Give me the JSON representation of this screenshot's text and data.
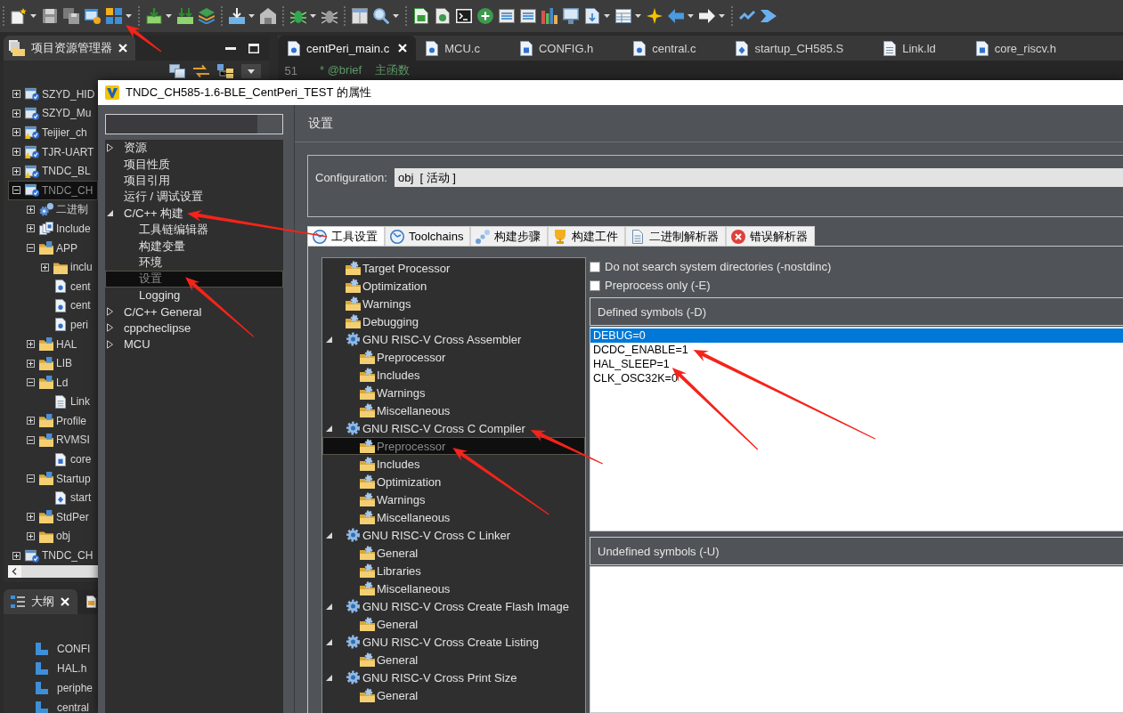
{
  "toolbar": [
    {
      "kind": "separator"
    },
    {
      "kind": "new",
      "dropdown": true,
      "arrow": false
    },
    {
      "kind": "save",
      "dropdown": false,
      "arrow": false
    },
    {
      "kind": "save-all",
      "dropdown": false,
      "arrow": false
    },
    {
      "kind": "window-gear",
      "dropdown": false,
      "arrow": false
    },
    {
      "kind": "grid",
      "dropdown": true,
      "arrow": true
    },
    {
      "kind": "separator"
    },
    {
      "kind": "download",
      "dropdown": true,
      "arrow": false
    },
    {
      "kind": "double-download",
      "dropdown": false,
      "arrow": false
    },
    {
      "kind": "layers",
      "dropdown": false,
      "arrow": false
    },
    {
      "kind": "separator"
    },
    {
      "kind": "tray",
      "dropdown": true,
      "arrow": false
    },
    {
      "kind": "house",
      "dropdown": false,
      "arrow": false
    },
    {
      "kind": "separator"
    },
    {
      "kind": "bug",
      "dropdown": true,
      "arrow": false
    },
    {
      "kind": "bug-off",
      "dropdown": false,
      "arrow": false
    },
    {
      "kind": "separator"
    },
    {
      "kind": "window",
      "dropdown": false,
      "arrow": false
    },
    {
      "kind": "search",
      "dropdown": true,
      "arrow": false
    },
    {
      "kind": "separator"
    },
    {
      "kind": "sheet",
      "dropdown": false,
      "arrow": false
    },
    {
      "kind": "help-doc",
      "dropdown": false,
      "arrow": false
    },
    {
      "kind": "terminal",
      "dropdown": false,
      "arrow": false
    },
    {
      "kind": "plus-circle",
      "dropdown": false,
      "arrow": false
    },
    {
      "kind": "list",
      "dropdown": false,
      "arrow": false
    },
    {
      "kind": "list",
      "dropdown": false,
      "arrow": false
    },
    {
      "kind": "bars",
      "dropdown": false,
      "arrow": false
    },
    {
      "kind": "monitor",
      "dropdown": false,
      "arrow": false
    },
    {
      "kind": "doc-down",
      "dropdown": true,
      "arrow": false
    },
    {
      "kind": "table",
      "dropdown": true,
      "arrow": false
    },
    {
      "kind": "sparkle",
      "dropdown": false,
      "arrow": false
    },
    {
      "kind": "back",
      "dropdown": true,
      "arrow": false
    },
    {
      "kind": "forward",
      "dropdown": true,
      "arrow": false
    },
    {
      "kind": "separator"
    },
    {
      "kind": "zigzag",
      "dropdown": false,
      "arrow": false
    },
    {
      "kind": "chevron",
      "dropdown": false,
      "arrow": false
    }
  ],
  "explorer": {
    "title": "项目资源管理器",
    "tree": [
      {
        "label": "SZYD_HID",
        "kind": "project",
        "expanded": false,
        "selected": false
      },
      {
        "label": "SZYD_Mu",
        "kind": "project",
        "expanded": false,
        "selected": false
      },
      {
        "label": "Teijier_ch",
        "kind": "project-warning",
        "expanded": false,
        "selected": false
      },
      {
        "label": "TJR-UART",
        "kind": "project-warning",
        "expanded": false,
        "selected": false
      },
      {
        "label": "TNDC_BL",
        "kind": "project-warning",
        "expanded": false,
        "selected": false
      },
      {
        "label": "TNDC_CH",
        "kind": "project",
        "expanded": true,
        "selected": true,
        "children": [
          {
            "label": "二进制",
            "kind": "binaries",
            "expanded": false,
            "selected": false
          },
          {
            "label": "Include",
            "kind": "includes",
            "expanded": false,
            "selected": false
          },
          {
            "label": "APP",
            "kind": "source-folder",
            "expanded": true,
            "selected": false,
            "children": [
              {
                "label": "inclu",
                "kind": "folder",
                "expanded": false,
                "selected": false
              },
              {
                "label": "cent",
                "kind": "c-file",
                "selected": false
              },
              {
                "label": "cent",
                "kind": "c-file",
                "selected": false
              },
              {
                "label": "peri",
                "kind": "c-file",
                "selected": false
              }
            ]
          },
          {
            "label": "HAL",
            "kind": "source-folder",
            "expanded": false,
            "selected": false
          },
          {
            "label": "LIB",
            "kind": "source-folder",
            "expanded": false,
            "selected": false
          },
          {
            "label": "Ld",
            "kind": "source-folder",
            "expanded": true,
            "selected": false,
            "children": [
              {
                "label": "Link",
                "kind": "text-file",
                "selected": false
              }
            ]
          },
          {
            "label": "Profile",
            "kind": "source-folder",
            "expanded": false,
            "selected": false
          },
          {
            "label": "RVMSI",
            "kind": "source-folder",
            "expanded": true,
            "selected": false,
            "children": [
              {
                "label": "core",
                "kind": "h-file",
                "selected": false
              }
            ]
          },
          {
            "label": "Startup",
            "kind": "source-folder",
            "expanded": true,
            "selected": false,
            "children": [
              {
                "label": "start",
                "kind": "s-file",
                "selected": false
              }
            ]
          },
          {
            "label": "StdPer",
            "kind": "source-folder",
            "expanded": false,
            "selected": false
          },
          {
            "label": "obj",
            "kind": "folder",
            "expanded": false,
            "selected": false
          }
        ]
      },
      {
        "label": "TNDC_CH",
        "kind": "project",
        "expanded": false,
        "selected": false
      }
    ]
  },
  "outline": {
    "title": "大纲",
    "items": [
      "CONFI",
      "HAL.h",
      "periphe",
      "central"
    ]
  },
  "editor": {
    "tabs": [
      {
        "label": "centPeri_main.c",
        "kind": "c-file",
        "selected": true
      },
      {
        "label": "MCU.c",
        "kind": "c-file",
        "selected": false
      },
      {
        "label": "CONFIG.h",
        "kind": "h-file",
        "selected": false
      },
      {
        "label": "central.c",
        "kind": "c-file",
        "selected": false
      },
      {
        "label": "startup_CH585.S",
        "kind": "s-file",
        "selected": false
      },
      {
        "label": "Link.ld",
        "kind": "text-file",
        "selected": false
      },
      {
        "label": "core_riscv.h",
        "kind": "h-file",
        "selected": false
      }
    ],
    "line_number": "51",
    "code": "* @brief    主函数"
  },
  "dialog": {
    "title": "TNDC_CH585-1.6-BLE_CentPeri_TEST 的属性",
    "nav": [
      {
        "label": "资源",
        "expanded": false,
        "selected": false,
        "arrow": false
      },
      {
        "label": "项目性质",
        "selected": false,
        "arrow": false
      },
      {
        "label": "项目引用",
        "selected": false,
        "arrow": false
      },
      {
        "label": "运行 / 调试设置",
        "selected": false,
        "arrow": false
      },
      {
        "label": "C/C++ 构建",
        "expanded": true,
        "selected": false,
        "arrow": true,
        "children": [
          {
            "label": "工具链编辑器",
            "selected": false,
            "arrow": false
          },
          {
            "label": "构建变量",
            "selected": false,
            "arrow": false
          },
          {
            "label": "环境",
            "selected": false,
            "arrow": false
          },
          {
            "label": "设置",
            "selected": true,
            "arrow": true
          },
          {
            "label": "Logging",
            "selected": false,
            "arrow": false
          }
        ]
      },
      {
        "label": "C/C++ General",
        "expanded": false,
        "selected": false,
        "arrow": false
      },
      {
        "label": "cppcheclipse",
        "expanded": false,
        "selected": false,
        "arrow": false
      },
      {
        "label": "MCU",
        "expanded": false,
        "selected": false,
        "arrow": false
      }
    ],
    "page_title": "设置",
    "configuration": {
      "label": "Configuration:",
      "value": "obj  [ 活动 ]"
    },
    "tabs": [
      {
        "label": "工具设置",
        "kind": "tool-settings",
        "selected": true
      },
      {
        "label": "Toolchains",
        "kind": "toolchains",
        "selected": false
      },
      {
        "label": "构建步骤",
        "kind": "build-steps",
        "selected": false
      },
      {
        "label": "构建工件",
        "kind": "artifacts",
        "selected": false
      },
      {
        "label": "二进制解析器",
        "kind": "binary-parsers",
        "selected": false
      },
      {
        "label": "错误解析器",
        "kind": "error-parsers",
        "selected": false
      }
    ],
    "tool_tree": [
      {
        "label": "Target Processor",
        "kind": "options",
        "selected": false,
        "arrow": false
      },
      {
        "label": "Optimization",
        "kind": "options",
        "selected": false,
        "arrow": false
      },
      {
        "label": "Warnings",
        "kind": "options",
        "selected": false,
        "arrow": false
      },
      {
        "label": "Debugging",
        "kind": "options",
        "selected": false,
        "arrow": false
      },
      {
        "label": "GNU RISC-V Cross Assembler",
        "kind": "tool",
        "expanded": true,
        "selected": false,
        "arrow": false,
        "children": [
          {
            "label": "Preprocessor",
            "kind": "options",
            "selected": false,
            "arrow": false
          },
          {
            "label": "Includes",
            "kind": "options",
            "selected": false,
            "arrow": false
          },
          {
            "label": "Warnings",
            "kind": "options",
            "selected": false,
            "arrow": false
          },
          {
            "label": "Miscellaneous",
            "kind": "options",
            "selected": false,
            "arrow": false
          }
        ]
      },
      {
        "label": "GNU RISC-V Cross C Compiler",
        "kind": "tool",
        "expanded": true,
        "selected": false,
        "arrow": true,
        "children": [
          {
            "label": "Preprocessor",
            "kind": "options",
            "selected": true,
            "arrow": true
          },
          {
            "label": "Includes",
            "kind": "options",
            "selected": false,
            "arrow": false
          },
          {
            "label": "Optimization",
            "kind": "options",
            "selected": false,
            "arrow": false
          },
          {
            "label": "Warnings",
            "kind": "options",
            "selected": false,
            "arrow": false
          },
          {
            "label": "Miscellaneous",
            "kind": "options",
            "selected": false,
            "arrow": false
          }
        ]
      },
      {
        "label": "GNU RISC-V Cross C Linker",
        "kind": "tool",
        "expanded": true,
        "selected": false,
        "arrow": false,
        "children": [
          {
            "label": "General",
            "kind": "options",
            "selected": false,
            "arrow": false
          },
          {
            "label": "Libraries",
            "kind": "options",
            "selected": false,
            "arrow": false
          },
          {
            "label": "Miscellaneous",
            "kind": "options",
            "selected": false,
            "arrow": false
          }
        ]
      },
      {
        "label": "GNU RISC-V Cross Create Flash Image",
        "kind": "tool",
        "expanded": true,
        "selected": false,
        "arrow": false,
        "children": [
          {
            "label": "General",
            "kind": "options",
            "selected": false,
            "arrow": false
          }
        ]
      },
      {
        "label": "GNU RISC-V Cross Create Listing",
        "kind": "tool",
        "expanded": true,
        "selected": false,
        "arrow": false,
        "children": [
          {
            "label": "General",
            "kind": "options",
            "selected": false,
            "arrow": false
          }
        ]
      },
      {
        "label": "GNU RISC-V Cross Print Size",
        "kind": "tool",
        "expanded": true,
        "selected": false,
        "arrow": false,
        "children": [
          {
            "label": "General",
            "kind": "options",
            "selected": false,
            "arrow": false
          }
        ]
      }
    ],
    "options": [
      {
        "label": "Do not search system directories (-nostdinc)",
        "checked": false
      },
      {
        "label": "Preprocess only (-E)",
        "checked": false
      }
    ],
    "defined_symbols": {
      "title": "Defined symbols (-D)",
      "items": [
        {
          "text": "DEBUG=0",
          "selected": true,
          "arrow": false
        },
        {
          "text": "DCDC_ENABLE=1",
          "selected": false,
          "arrow": true
        },
        {
          "text": "HAL_SLEEP=1",
          "selected": false,
          "arrow": true
        },
        {
          "text": "CLK_OSC32K=0",
          "selected": false,
          "arrow": false
        }
      ]
    },
    "undefined_symbols": {
      "title": "Undefined symbols (-U)"
    }
  }
}
